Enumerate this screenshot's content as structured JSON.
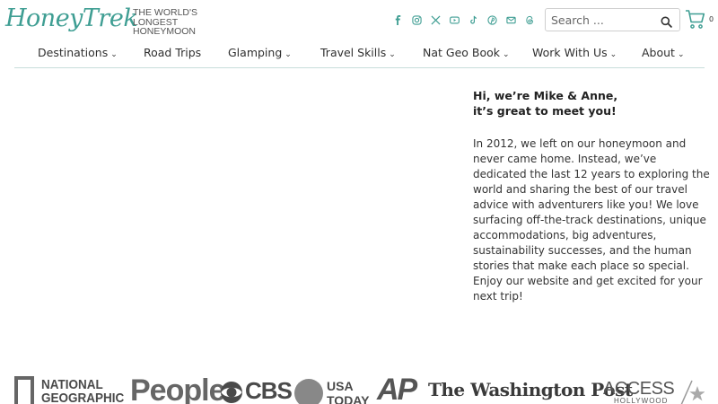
{
  "brand": {
    "script": "HoneyTrek",
    "tagline": [
      "THE WORLD'S",
      "LONGEST",
      "HONEYMOON"
    ]
  },
  "socials": [
    {
      "icon": "facebook-icon"
    },
    {
      "icon": "instagram-icon"
    },
    {
      "icon": "x-icon"
    },
    {
      "icon": "youtube-icon"
    },
    {
      "icon": "tiktok-icon"
    },
    {
      "icon": "pinterest-icon"
    },
    {
      "icon": "email-icon"
    },
    {
      "icon": "threads-icon"
    }
  ],
  "search": {
    "placeholder": "Search ..."
  },
  "cart": {
    "count": "0"
  },
  "nav": {
    "items": [
      {
        "label": "Destinations",
        "has_dropdown": true
      },
      {
        "label": "Road Trips",
        "has_dropdown": false
      },
      {
        "label": "Glamping",
        "has_dropdown": true
      },
      {
        "label": "Travel Skills",
        "has_dropdown": true
      },
      {
        "label": "Nat Geo Book",
        "has_dropdown": true
      },
      {
        "label": "Work With Us",
        "has_dropdown": true
      },
      {
        "label": "About",
        "has_dropdown": true
      }
    ],
    "chevron": "⌄"
  },
  "intro": {
    "greeting_line1": "Hi, we’re Mike & Anne,",
    "greeting_line2": "it’s great to meet you!",
    "bio": "In 2012, we left on our honeymoon and never came home. Instead, we’ve dedicated the last 12 years to exploring the world and sharing the best of our travel advice with adventurers like you! We love surfacing off-the-track destinations, unique accommodations, big adventures, sustainability successes, and the human stories that make each place so special. Enjoy our website and get excited for your next trip!"
  },
  "press": {
    "natgeo": [
      "NATIONAL",
      "GEOGRAPHIC"
    ],
    "people": "People",
    "cbs": "CBS",
    "usatoday": [
      "USA",
      "TODAY"
    ],
    "ap": "AP",
    "wapo": "The Washington Post",
    "access": "ACCESS",
    "access_sub": "HOLLYWOOD"
  },
  "colors": {
    "accent": "#3f9e93",
    "text": "#333333",
    "nav_border": "#c7dedb"
  }
}
